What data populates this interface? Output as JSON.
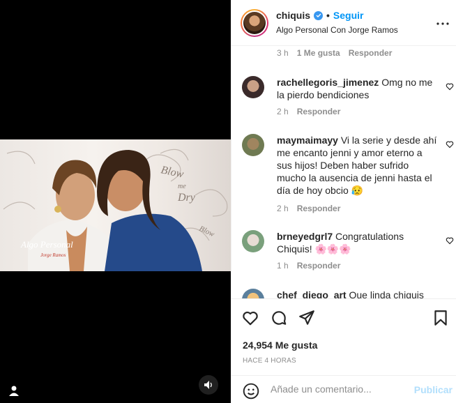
{
  "post": {
    "username": "chiquis",
    "separator": "•",
    "follow_label": "Seguir",
    "subtitle": "Algo Personal Con Jorge Ramos"
  },
  "video_overlay": {
    "left_logo": "Algo Personal",
    "left_logo_sub": "Jorge Ramos",
    "backdrop_text_1": "Blow",
    "backdrop_text_2": "me",
    "backdrop_text_3": "Dry"
  },
  "top_meta": {
    "time": "3 h",
    "likes": "1 Me gusta",
    "reply": "Responder"
  },
  "comments": [
    {
      "user": "rachellegoris_jimenez",
      "text": "Omg no me la pierdo bendiciones",
      "time": "2 h",
      "reply": "Responder"
    },
    {
      "user": "maymaimayy",
      "text": "Vi la serie y desde ahí me encanto jenni y amor eterno a sus hijos! Deben haber sufrido mucho la ausencia de jenni hasta el día de hoy obcio 😥",
      "time": "2 h",
      "reply": "Responder"
    },
    {
      "user": "brneyedgrl7",
      "text": "Congratulations Chiquis! 🌸🌸🌸",
      "time": "1 h",
      "reply": "Responder"
    },
    {
      "user": "chef_diego_art",
      "text": "Que linda chiquis"
    }
  ],
  "stats": {
    "likes": "24,954 Me gusta",
    "posted": "HACE 4 HORAS"
  },
  "composer": {
    "placeholder": "Añade un comentario...",
    "publish": "Publicar"
  },
  "icons": {
    "verified": "verified-badge-icon",
    "more": "more-options-icon",
    "like": "heart-icon",
    "comment": "comment-icon",
    "share": "share-icon",
    "save": "bookmark-icon",
    "emoji": "emoji-icon",
    "sound": "sound-icon",
    "user": "user-tag-icon"
  },
  "colors": {
    "accent": "#0095f6",
    "publish_disabled": "#b2dffc",
    "muted": "#8e8e8e",
    "verified": "#3897f0"
  }
}
